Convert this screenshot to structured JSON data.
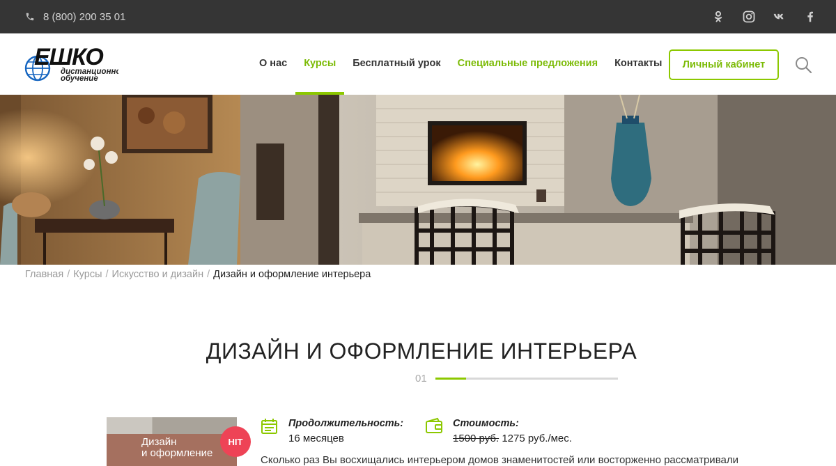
{
  "topbar": {
    "phone": "8 (800) 200 35 01",
    "socials": [
      "odnoklassniki-icon",
      "instagram-icon",
      "vk-icon",
      "facebook-icon"
    ]
  },
  "logo": {
    "brand": "ЕШКО",
    "tagline_1": "дистанционное",
    "tagline_2": "обучение"
  },
  "nav": {
    "items": [
      {
        "label": "О нас"
      },
      {
        "label": "Курсы"
      },
      {
        "label": "Бесплатный урок"
      },
      {
        "label": "Специальные предложения"
      },
      {
        "label": "Контакты"
      }
    ],
    "cabinet": "Личный кабинет"
  },
  "breadcrumb": {
    "items": [
      "Главная",
      "Курсы",
      "Искусство и дизайн"
    ],
    "separator": "/",
    "current": "Дизайн и оформление интерьера"
  },
  "page": {
    "title": "ДИЗАЙН И ОФОРМЛЕНИЕ ИНТЕРЬЕРА",
    "slide_number": "01",
    "slide_progress": 0.17
  },
  "course": {
    "cover_title_1": "Дизайн",
    "cover_title_2": "и оформление",
    "badge": "HIT",
    "duration_label": "Продолжительность:",
    "duration_value": "16 месяцев",
    "price_label": "Стоимость:",
    "price_old": "1500 руб.",
    "price_new": "1275 руб./мес.",
    "description": "Сколько раз Вы восхищались интерьером домов знаменитостей или восторженно рассматривали"
  },
  "colors": {
    "accent": "#8cc800",
    "topbar_bg": "#353535",
    "badge": "#ee4356"
  }
}
